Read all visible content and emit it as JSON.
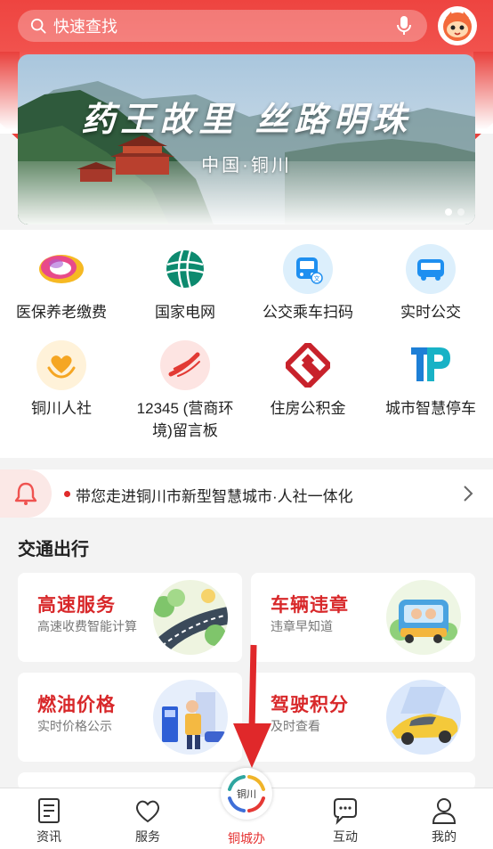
{
  "search": {
    "placeholder": "快速查找",
    "search_icon": "search-icon",
    "voice_icon": "microphone-icon"
  },
  "avatar": {
    "icon": "mascot-avatar-icon"
  },
  "banner": {
    "title": "药王故里 丝路明珠",
    "subtitle": "中国·铜川",
    "slides": 2,
    "active_slide": 1
  },
  "services": [
    {
      "label": "医保养老缴费",
      "icon": "insurance-payment-icon"
    },
    {
      "label": "国家电网",
      "icon": "state-grid-icon"
    },
    {
      "label": "公交乘车扫码",
      "icon": "bus-qr-icon"
    },
    {
      "label": "实时公交",
      "icon": "realtime-bus-icon"
    },
    {
      "label": "铜川人社",
      "icon": "social-security-icon"
    },
    {
      "label": "12345 (营商环\n境)留言板",
      "icon": "hotline-12345-icon"
    },
    {
      "label": "住房公积金",
      "icon": "housing-fund-icon"
    },
    {
      "label": "城市智慧停车",
      "icon": "smart-parking-icon"
    }
  ],
  "notice": {
    "text": "带您走进铜川市新型智慧城市·人社一体化",
    "icon": "bell-icon"
  },
  "section": {
    "title": "交通出行"
  },
  "cards": [
    {
      "title": "高速服务",
      "subtitle": "高速收费智能计算",
      "icon": "highway-illustration"
    },
    {
      "title": "车辆违章",
      "subtitle": "违章早知道",
      "icon": "car-violation-illustration"
    },
    {
      "title": "燃油价格",
      "subtitle": "实时价格公示",
      "icon": "fuel-price-illustration"
    },
    {
      "title": "驾驶积分",
      "subtitle": "及时查看",
      "icon": "driving-score-illustration"
    }
  ],
  "tabs": [
    {
      "label": "资讯",
      "icon": "news-icon"
    },
    {
      "label": "服务",
      "icon": "heart-icon"
    },
    {
      "label": "铜城办",
      "icon": "tongcheng-logo-icon",
      "active": true
    },
    {
      "label": "互动",
      "icon": "chat-icon"
    },
    {
      "label": "我的",
      "icon": "user-icon"
    }
  ],
  "center_logo_text": "铜川",
  "colors": {
    "brand_red": "#e53030",
    "header_red": "#ee4440",
    "card_title": "#d8282a"
  }
}
